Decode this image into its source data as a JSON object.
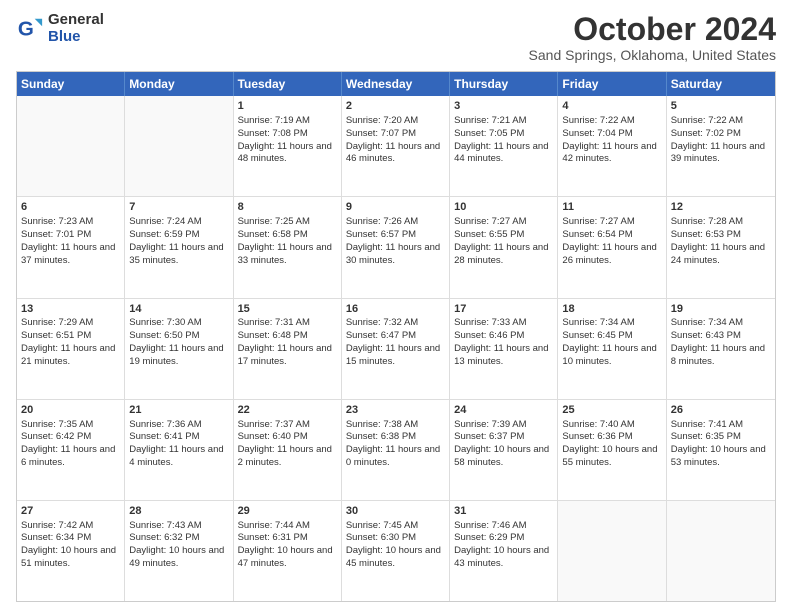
{
  "header": {
    "logo_general": "General",
    "logo_blue": "Blue",
    "title": "October 2024",
    "location": "Sand Springs, Oklahoma, United States"
  },
  "days_of_week": [
    "Sunday",
    "Monday",
    "Tuesday",
    "Wednesday",
    "Thursday",
    "Friday",
    "Saturday"
  ],
  "weeks": [
    [
      {
        "day": "",
        "sunrise": "",
        "sunset": "",
        "daylight": ""
      },
      {
        "day": "",
        "sunrise": "",
        "sunset": "",
        "daylight": ""
      },
      {
        "day": "1",
        "sunrise": "Sunrise: 7:19 AM",
        "sunset": "Sunset: 7:08 PM",
        "daylight": "Daylight: 11 hours and 48 minutes."
      },
      {
        "day": "2",
        "sunrise": "Sunrise: 7:20 AM",
        "sunset": "Sunset: 7:07 PM",
        "daylight": "Daylight: 11 hours and 46 minutes."
      },
      {
        "day": "3",
        "sunrise": "Sunrise: 7:21 AM",
        "sunset": "Sunset: 7:05 PM",
        "daylight": "Daylight: 11 hours and 44 minutes."
      },
      {
        "day": "4",
        "sunrise": "Sunrise: 7:22 AM",
        "sunset": "Sunset: 7:04 PM",
        "daylight": "Daylight: 11 hours and 42 minutes."
      },
      {
        "day": "5",
        "sunrise": "Sunrise: 7:22 AM",
        "sunset": "Sunset: 7:02 PM",
        "daylight": "Daylight: 11 hours and 39 minutes."
      }
    ],
    [
      {
        "day": "6",
        "sunrise": "Sunrise: 7:23 AM",
        "sunset": "Sunset: 7:01 PM",
        "daylight": "Daylight: 11 hours and 37 minutes."
      },
      {
        "day": "7",
        "sunrise": "Sunrise: 7:24 AM",
        "sunset": "Sunset: 6:59 PM",
        "daylight": "Daylight: 11 hours and 35 minutes."
      },
      {
        "day": "8",
        "sunrise": "Sunrise: 7:25 AM",
        "sunset": "Sunset: 6:58 PM",
        "daylight": "Daylight: 11 hours and 33 minutes."
      },
      {
        "day": "9",
        "sunrise": "Sunrise: 7:26 AM",
        "sunset": "Sunset: 6:57 PM",
        "daylight": "Daylight: 11 hours and 30 minutes."
      },
      {
        "day": "10",
        "sunrise": "Sunrise: 7:27 AM",
        "sunset": "Sunset: 6:55 PM",
        "daylight": "Daylight: 11 hours and 28 minutes."
      },
      {
        "day": "11",
        "sunrise": "Sunrise: 7:27 AM",
        "sunset": "Sunset: 6:54 PM",
        "daylight": "Daylight: 11 hours and 26 minutes."
      },
      {
        "day": "12",
        "sunrise": "Sunrise: 7:28 AM",
        "sunset": "Sunset: 6:53 PM",
        "daylight": "Daylight: 11 hours and 24 minutes."
      }
    ],
    [
      {
        "day": "13",
        "sunrise": "Sunrise: 7:29 AM",
        "sunset": "Sunset: 6:51 PM",
        "daylight": "Daylight: 11 hours and 21 minutes."
      },
      {
        "day": "14",
        "sunrise": "Sunrise: 7:30 AM",
        "sunset": "Sunset: 6:50 PM",
        "daylight": "Daylight: 11 hours and 19 minutes."
      },
      {
        "day": "15",
        "sunrise": "Sunrise: 7:31 AM",
        "sunset": "Sunset: 6:48 PM",
        "daylight": "Daylight: 11 hours and 17 minutes."
      },
      {
        "day": "16",
        "sunrise": "Sunrise: 7:32 AM",
        "sunset": "Sunset: 6:47 PM",
        "daylight": "Daylight: 11 hours and 15 minutes."
      },
      {
        "day": "17",
        "sunrise": "Sunrise: 7:33 AM",
        "sunset": "Sunset: 6:46 PM",
        "daylight": "Daylight: 11 hours and 13 minutes."
      },
      {
        "day": "18",
        "sunrise": "Sunrise: 7:34 AM",
        "sunset": "Sunset: 6:45 PM",
        "daylight": "Daylight: 11 hours and 10 minutes."
      },
      {
        "day": "19",
        "sunrise": "Sunrise: 7:34 AM",
        "sunset": "Sunset: 6:43 PM",
        "daylight": "Daylight: 11 hours and 8 minutes."
      }
    ],
    [
      {
        "day": "20",
        "sunrise": "Sunrise: 7:35 AM",
        "sunset": "Sunset: 6:42 PM",
        "daylight": "Daylight: 11 hours and 6 minutes."
      },
      {
        "day": "21",
        "sunrise": "Sunrise: 7:36 AM",
        "sunset": "Sunset: 6:41 PM",
        "daylight": "Daylight: 11 hours and 4 minutes."
      },
      {
        "day": "22",
        "sunrise": "Sunrise: 7:37 AM",
        "sunset": "Sunset: 6:40 PM",
        "daylight": "Daylight: 11 hours and 2 minutes."
      },
      {
        "day": "23",
        "sunrise": "Sunrise: 7:38 AM",
        "sunset": "Sunset: 6:38 PM",
        "daylight": "Daylight: 11 hours and 0 minutes."
      },
      {
        "day": "24",
        "sunrise": "Sunrise: 7:39 AM",
        "sunset": "Sunset: 6:37 PM",
        "daylight": "Daylight: 10 hours and 58 minutes."
      },
      {
        "day": "25",
        "sunrise": "Sunrise: 7:40 AM",
        "sunset": "Sunset: 6:36 PM",
        "daylight": "Daylight: 10 hours and 55 minutes."
      },
      {
        "day": "26",
        "sunrise": "Sunrise: 7:41 AM",
        "sunset": "Sunset: 6:35 PM",
        "daylight": "Daylight: 10 hours and 53 minutes."
      }
    ],
    [
      {
        "day": "27",
        "sunrise": "Sunrise: 7:42 AM",
        "sunset": "Sunset: 6:34 PM",
        "daylight": "Daylight: 10 hours and 51 minutes."
      },
      {
        "day": "28",
        "sunrise": "Sunrise: 7:43 AM",
        "sunset": "Sunset: 6:32 PM",
        "daylight": "Daylight: 10 hours and 49 minutes."
      },
      {
        "day": "29",
        "sunrise": "Sunrise: 7:44 AM",
        "sunset": "Sunset: 6:31 PM",
        "daylight": "Daylight: 10 hours and 47 minutes."
      },
      {
        "day": "30",
        "sunrise": "Sunrise: 7:45 AM",
        "sunset": "Sunset: 6:30 PM",
        "daylight": "Daylight: 10 hours and 45 minutes."
      },
      {
        "day": "31",
        "sunrise": "Sunrise: 7:46 AM",
        "sunset": "Sunset: 6:29 PM",
        "daylight": "Daylight: 10 hours and 43 minutes."
      },
      {
        "day": "",
        "sunrise": "",
        "sunset": "",
        "daylight": ""
      },
      {
        "day": "",
        "sunrise": "",
        "sunset": "",
        "daylight": ""
      }
    ]
  ]
}
